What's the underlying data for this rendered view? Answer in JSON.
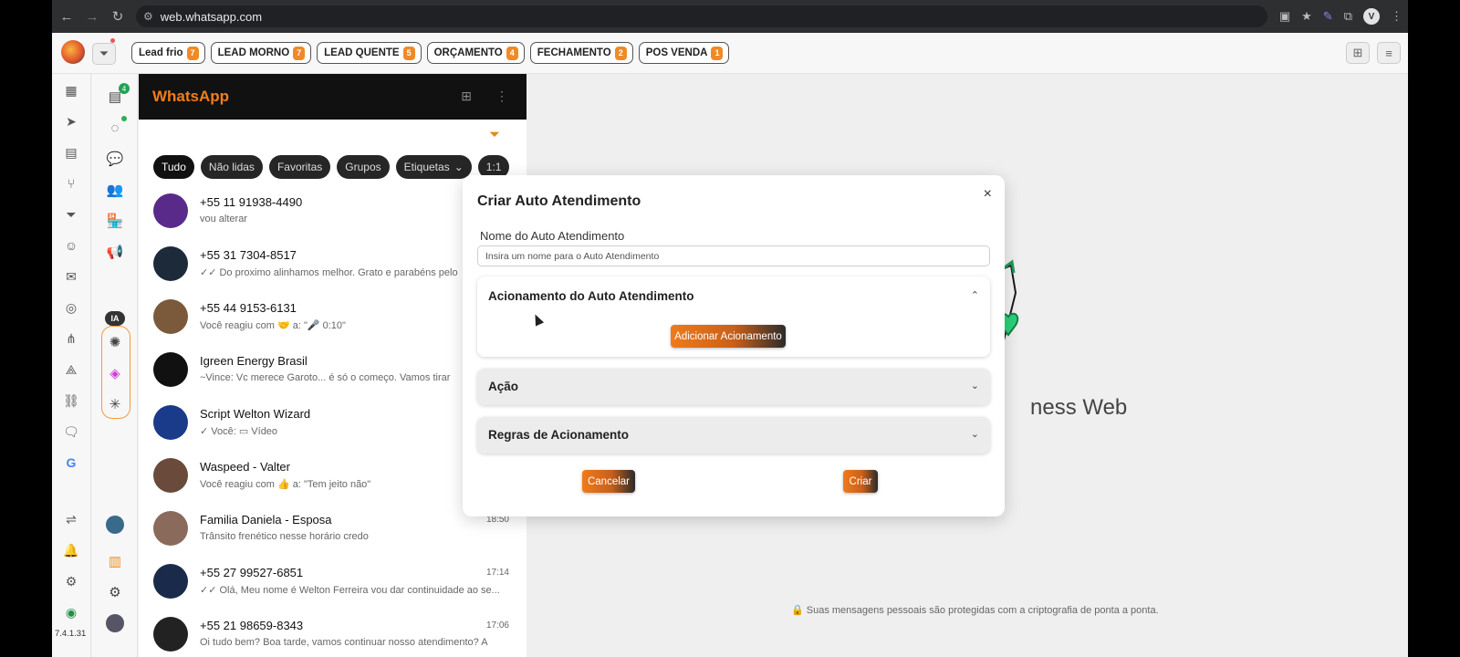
{
  "browser": {
    "url": "web.whatsapp.com"
  },
  "tagbar": {
    "tags": [
      {
        "label": "Lead frio",
        "count": "7"
      },
      {
        "label": "LEAD MORNO",
        "count": "7"
      },
      {
        "label": "LEAD QUENTE",
        "count": "5"
      },
      {
        "label": "ORÇAMENTO",
        "count": "4"
      },
      {
        "label": "FECHAMENTO",
        "count": "2"
      },
      {
        "label": "POS VENDA",
        "count": "1"
      }
    ]
  },
  "rail": {
    "version": "7.4.1.31",
    "chats_badge": "4",
    "ia_label": "IA"
  },
  "chatpanel": {
    "title": "WhatsApp",
    "chips": [
      "Tudo",
      "Não lidas",
      "Favoritas",
      "Grupos",
      "Etiquetas",
      "1:1"
    ],
    "chats": [
      {
        "name": "+55 11 91938-4490",
        "message": "vou alterar",
        "time": "",
        "avatar": "#5a2a8a"
      },
      {
        "name": "+55 31 7304-8517",
        "message": "✓✓ Do proximo alinhamos melhor. Grato e parabéns  pelo",
        "time": "",
        "avatar": "#1c2a3a"
      },
      {
        "name": "+55 44 9153-6131",
        "message": "Você reagiu com 🤝 a: \"🎤 0:10\"",
        "time": "",
        "avatar": "#7a5a3a"
      },
      {
        "name": "Igreen Energy Brasil",
        "message": "~Vince: Vc merece Garoto... é só o começo. Vamos tirar",
        "time": "",
        "avatar": "#111"
      },
      {
        "name": "Script Welton Wizard",
        "message": "✓ Você: ▭ Vídeo",
        "time": "",
        "avatar": "#1a3a8a"
      },
      {
        "name": "Waspeed - Valter",
        "message": "Você reagiu com 👍 a: \"Tem jeito não\"",
        "time": "",
        "avatar": "#6a4a3a"
      },
      {
        "name": "Familia Daniela - Esposa",
        "message": "Trânsito frenético nesse horário credo",
        "time": "18:50",
        "avatar": "#8a6a5a"
      },
      {
        "name": "+55 27 99527-6851",
        "message": "✓✓ Olá, Meu nome é Welton Ferreira vou dar continuidade ao se...",
        "time": "17:14",
        "avatar": "#1a2a4a"
      },
      {
        "name": "+55 21 98659-8343",
        "message": "Oi tudo bem? Boa tarde, vamos continuar nosso atendimento? A",
        "time": "17:06",
        "avatar": "#222"
      }
    ]
  },
  "main": {
    "biz_text": "ness Web",
    "encryption_note": "Suas mensagens pessoais são protegidas com a criptografia de ponta a ponta."
  },
  "modal": {
    "title": "Criar Auto Atendimento",
    "close_label": "×",
    "name_label": "Nome do Auto Atendimento",
    "name_placeholder": "Insira um nome para o Auto Atendimento",
    "sections": [
      {
        "title": "Acionamento do Auto Atendimento",
        "expanded": true,
        "button": "Adicionar Acionamento"
      },
      {
        "title": "Ação",
        "expanded": false
      },
      {
        "title": "Regras de Acionamento",
        "expanded": false
      }
    ],
    "cancel_label": "Cancelar",
    "create_label": "Criar"
  },
  "colors": {
    "accent": "#f07e1a",
    "dark": "#111111",
    "whatsapp_green": "#25d366"
  }
}
